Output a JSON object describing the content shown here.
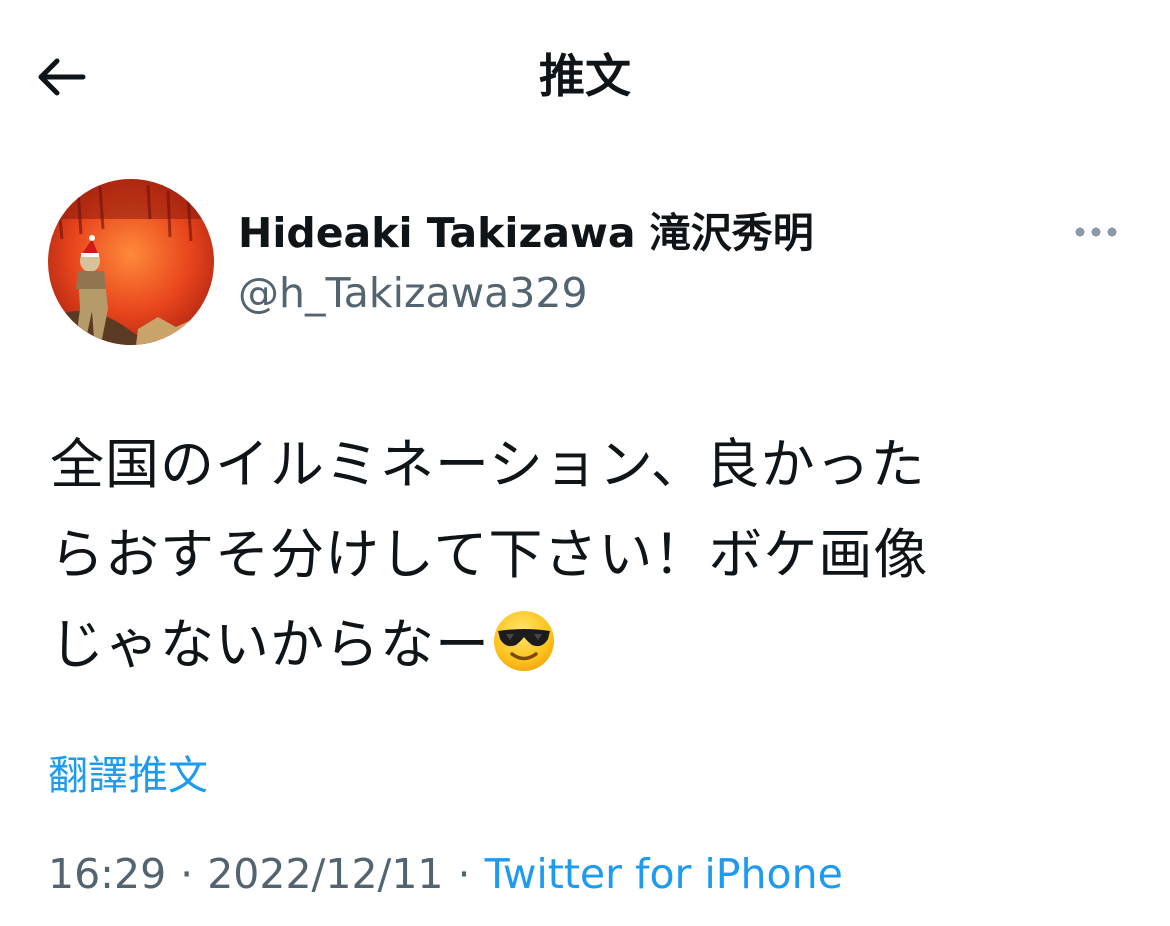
{
  "header": {
    "title": "推文"
  },
  "icons": {
    "back": "arrow-left-icon",
    "more": "more-horizontal-icon",
    "emoji": "smiling-face-with-sunglasses-icon"
  },
  "tweet": {
    "author": {
      "name": "Hideaki Takizawa 滝沢秀明",
      "handle": "@h_Takizawa329"
    },
    "text_lines": [
      "全国のイルミネーション、良かった",
      "らおすそ分けして下さい！ボケ画像",
      "じゃないからなー"
    ],
    "translate_label": "翻譯推文",
    "time": "16:29",
    "separator": "·",
    "date": "2022/12/11",
    "source": "Twitter for iPhone"
  },
  "colors": {
    "text": "#0f1419",
    "secondary": "#536471",
    "link": "#1d9bf0"
  }
}
